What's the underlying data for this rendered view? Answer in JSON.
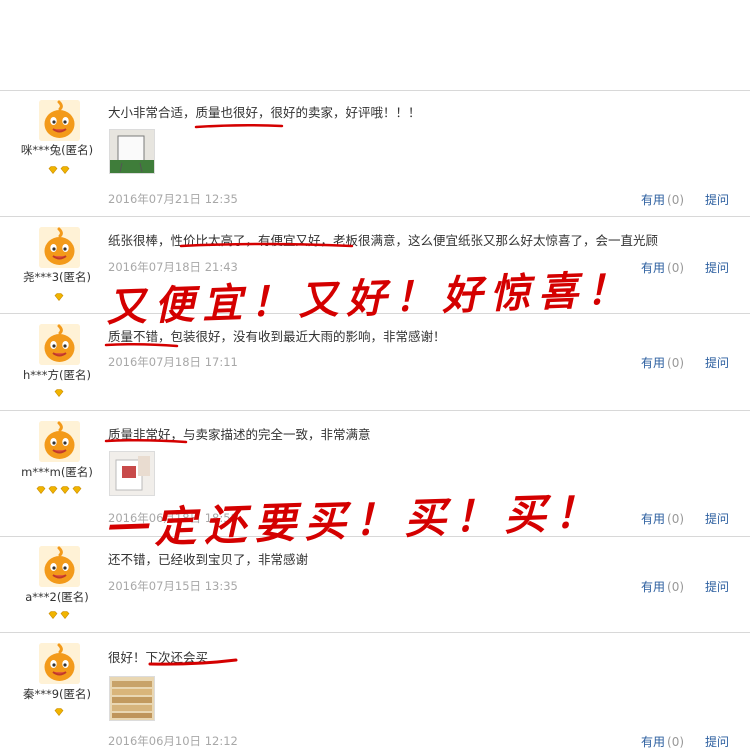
{
  "reviews": [
    {
      "nick": "咪***兔",
      "anon": "(匿名)",
      "badge_count": 2,
      "text": "大小非常合适，质量也很好，很好的卖家，好评哦！！！",
      "has_photo": true,
      "photo_icon": "whiteboard-photo",
      "date": "2016年07月21日 12:35",
      "useful_label": "有用",
      "useful_count": "(0)",
      "ask_label": "提问"
    },
    {
      "nick": "尧***3",
      "anon": "(匿名)",
      "badge_count": 1,
      "text": "纸张很棒，性价比太高了，有便宜又好，老板很满意，这么便宜纸张又那么好太惊喜了，会一直光顾",
      "has_photo": false,
      "date": "2016年07月18日 21:43",
      "useful_label": "有用",
      "useful_count": "(0)",
      "ask_label": "提问"
    },
    {
      "nick": "h***方",
      "anon": "(匿名)",
      "badge_count": 1,
      "text": "质量不错，包装很好，没有收到最近大雨的影响，非常感谢！",
      "has_photo": false,
      "date": "2016年07月18日 17:11",
      "useful_label": "有用",
      "useful_count": "(0)",
      "ask_label": "提问"
    },
    {
      "nick": "m***m",
      "anon": "(匿名)",
      "badge_count": 4,
      "text": "质量非常好，与卖家描述的完全一致，非常满意",
      "has_photo": true,
      "photo_icon": "package-photo",
      "date": "2016年06月18日 18:58",
      "useful_label": "有用",
      "useful_count": "(0)",
      "ask_label": "提问"
    },
    {
      "nick": "a***2",
      "anon": "(匿名)",
      "badge_count": 2,
      "text": "还不错，已经收到宝贝了，非常感谢",
      "has_photo": false,
      "date": "2016年07月15日 13:35",
      "useful_label": "有用",
      "useful_count": "(0)",
      "ask_label": "提问"
    },
    {
      "nick": "秦***9",
      "anon": "(匿名)",
      "badge_count": 1,
      "text": "很好！下次还会买",
      "has_photo": true,
      "photo_icon": "paper-rolls-photo",
      "date": "2016年06月10日 12:12",
      "useful_label": "有用",
      "useful_count": "(0)",
      "ask_label": "提问"
    }
  ],
  "annotations": {
    "line1": "又便宜！又好！好惊喜！",
    "line2": "一定还要买！买！买！"
  },
  "colors": {
    "link": "#2b5e9f",
    "annotation_red": "#d40000",
    "avatar_orange": "#f39a1a",
    "badge_gold": "#f0b400"
  }
}
